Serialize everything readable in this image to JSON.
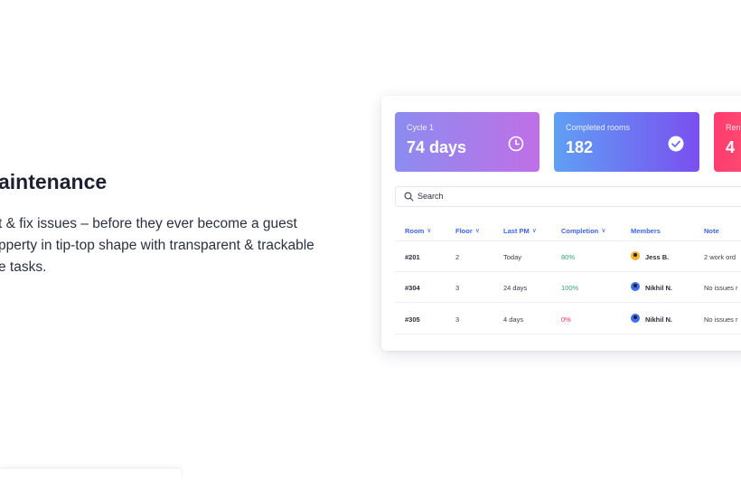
{
  "heading": "aintenance",
  "description_lines": [
    "t & fix issues – before they ever become a guest",
    "pperty in tip-top shape with transparent & trackable",
    "e tasks."
  ],
  "cards": [
    {
      "label": "Cycle 1",
      "value": "74 days",
      "icon": "clock-icon"
    },
    {
      "label": "Completed rooms",
      "value": "182",
      "icon": "check-circle-icon"
    },
    {
      "label": "Ren",
      "value": "4"
    }
  ],
  "search": {
    "placeholder": "Search"
  },
  "table": {
    "columns": [
      "Room",
      "Floor",
      "Last PM",
      "Completion",
      "Members",
      "Note"
    ],
    "rows": [
      {
        "room": "#201",
        "floor": "2",
        "last_pm": "Today",
        "completion": "80%",
        "member": "Jess B.",
        "note": "2 work ord"
      },
      {
        "room": "#304",
        "floor": "3",
        "last_pm": "24 days",
        "completion": "100%",
        "member": "Nikhil N.",
        "note": "No issues r"
      },
      {
        "room": "#305",
        "floor": "3",
        "last_pm": "4 days",
        "completion": "0%",
        "member": "Nikhil N.",
        "note": "No issues r"
      }
    ]
  },
  "colors": {
    "accent": "#3b64f2",
    "positive": "#2fa86a",
    "negative": "#ff2a5a"
  }
}
